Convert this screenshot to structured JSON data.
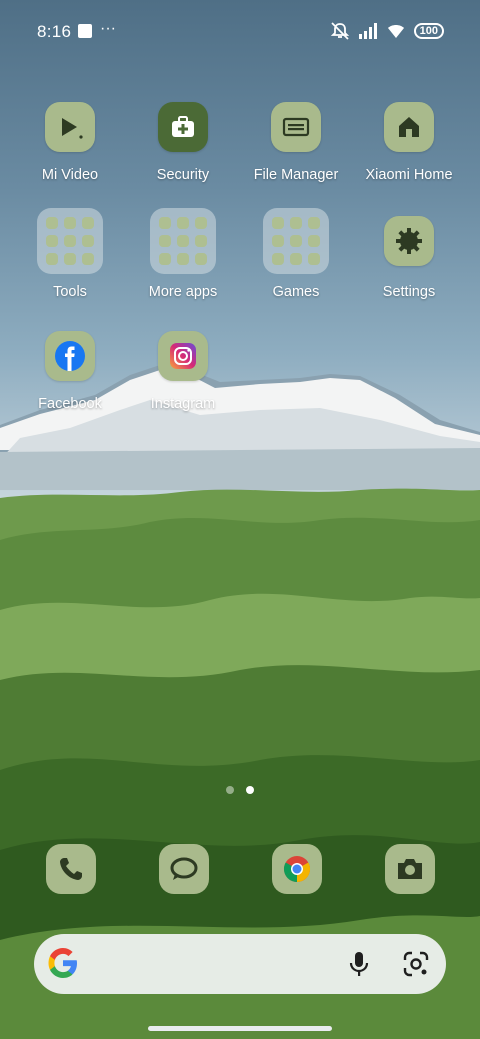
{
  "status_bar": {
    "time": "8:16",
    "overflow": "···",
    "battery": "100",
    "icons": [
      "notification-square-icon",
      "mute-icon",
      "signal-icon",
      "wifi-icon",
      "battery-icon"
    ]
  },
  "apps_row1": [
    {
      "label": "Mi Video",
      "icon": "play-icon"
    },
    {
      "label": "Security",
      "icon": "first-aid-icon"
    },
    {
      "label": "File Manager",
      "icon": "folder-icon"
    },
    {
      "label": "Xiaomi Home",
      "icon": "home-icon"
    }
  ],
  "apps_row2": [
    {
      "label": "Tools",
      "icon": "folder-grid-icon"
    },
    {
      "label": "More apps",
      "icon": "folder-grid-icon"
    },
    {
      "label": "Games",
      "icon": "folder-grid-icon"
    },
    {
      "label": "Settings",
      "icon": "gear-icon"
    }
  ],
  "apps_row3": [
    {
      "label": "Facebook",
      "icon": "facebook-icon"
    },
    {
      "label": "Instagram",
      "icon": "instagram-icon"
    }
  ],
  "page_indicator": {
    "pages": 2,
    "active": 2
  },
  "dock": [
    {
      "name": "phone",
      "icon": "phone-icon"
    },
    {
      "name": "messages",
      "icon": "message-icon"
    },
    {
      "name": "chrome",
      "icon": "chrome-icon"
    },
    {
      "name": "camera",
      "icon": "camera-icon"
    }
  ],
  "search_bar": {
    "icons": [
      "google-logo-icon",
      "mic-icon",
      "lens-icon"
    ]
  },
  "colors": {
    "icon_bg": "#a9ba8c",
    "icon_glyph": "#3b4a2a",
    "security_bg": "#4b6a36"
  }
}
